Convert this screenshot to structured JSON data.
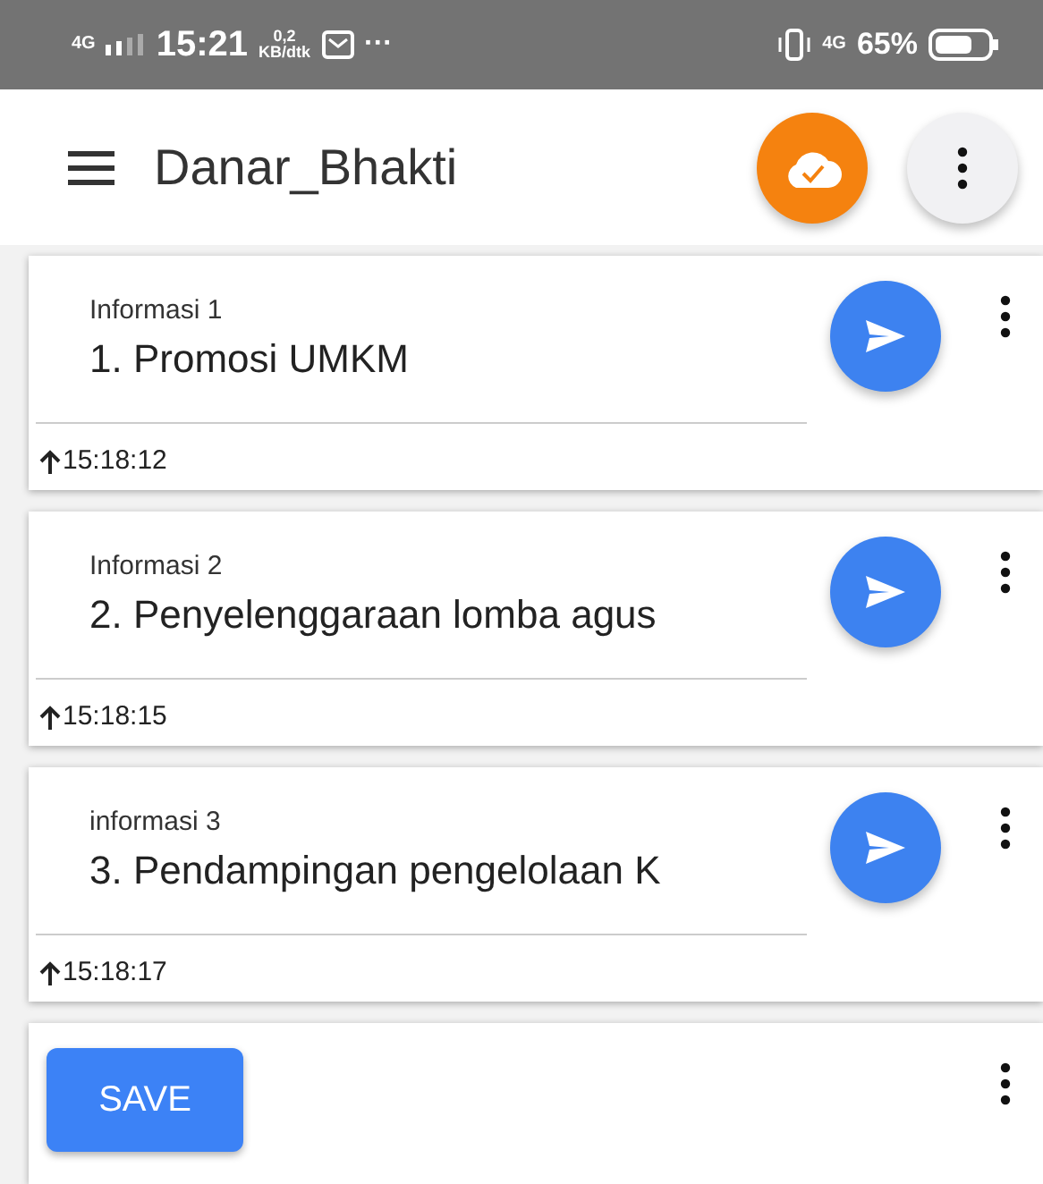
{
  "status_bar": {
    "network_left": "4G",
    "time": "15:21",
    "speed_value": "0,2",
    "speed_unit": "KB/dtk",
    "more": "···",
    "network_right": "4G",
    "battery": "65%"
  },
  "app_bar": {
    "title": "Danar_Bhakti"
  },
  "items": [
    {
      "label": "Informasi 1",
      "value": "1. Promosi UMKM",
      "time": "15:18:12"
    },
    {
      "label": "Informasi 2",
      "value": "2. Penyelenggaraan lomba agus",
      "time": "15:18:15"
    },
    {
      "label": "informasi 3",
      "value": "3. Pendampingan pengelolaan K",
      "time": "15:18:17"
    }
  ],
  "save_button": {
    "label": "SAVE"
  }
}
